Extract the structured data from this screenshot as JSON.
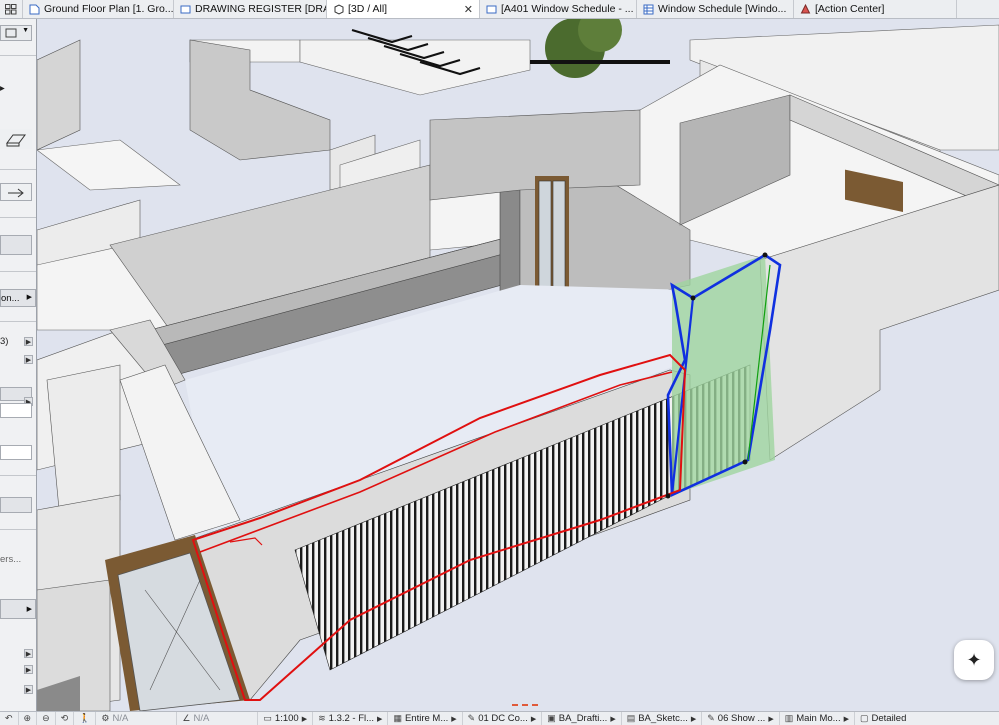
{
  "tabs": [
    {
      "label": "Ground Floor Plan [1. Gro...",
      "icon": "floor-plan-icon",
      "active": false
    },
    {
      "label": "DRAWING REGISTER [DRA...",
      "icon": "layout-icon",
      "active": false
    },
    {
      "label": "[3D / All]",
      "icon": "3d-view-icon",
      "active": true
    },
    {
      "label": "[A401 Window Schedule - ...",
      "icon": "layout-icon",
      "active": false
    },
    {
      "label": "Window Schedule [Windo...",
      "icon": "schedule-icon",
      "active": false
    },
    {
      "label": "[Action Center]",
      "icon": "action-center-icon",
      "active": false
    }
  ],
  "left_panel": {
    "truncated_label_1": "on...",
    "truncated_label_2": "3)",
    "truncated_label_3": "ers..."
  },
  "status_bar": {
    "na_1": "N/A",
    "na_2": "N/A",
    "scale": "1:100",
    "layer_combo": "1.3.2 - Fl...",
    "structure": "Entire M...",
    "pen_set": "01 DC Co...",
    "mvo": "BA_Drafti...",
    "graphic_override": "BA_Sketc...",
    "renovation": "06 Show ...",
    "model_view": "Main Mo...",
    "detail": "Detailed"
  },
  "colors": {
    "selection_red": "#e01010",
    "selection_blue": "#1030e0",
    "selection_green_fill": "#9fd49f"
  }
}
